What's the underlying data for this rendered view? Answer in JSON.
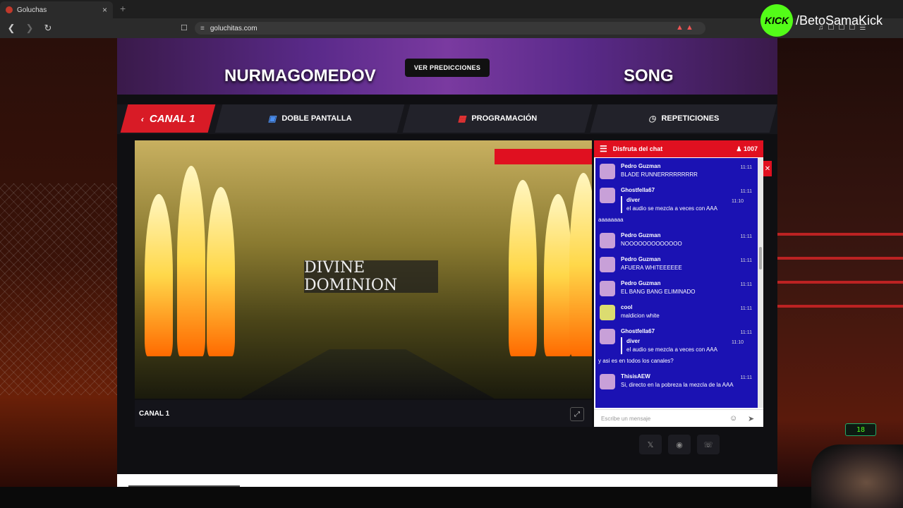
{
  "browser": {
    "tab_title": "Goluchas",
    "tab_close": "×",
    "new_tab": "+",
    "url": "goluchitas.com"
  },
  "overlay": {
    "kick_logo": "KICK",
    "kick_handle": "/BetoSamaKick",
    "viewer_badge": "18"
  },
  "banner": {
    "fighter_left": "NURMAGOMEDOV",
    "fighter_right": "SONG",
    "predictions_button": "VER PREDICCIONES"
  },
  "nav": {
    "tabs": [
      {
        "label": "CANAL 1",
        "icon": "chevron-left-icon"
      },
      {
        "label": "DOBLE PANTALLA",
        "icon": "monitor-icon"
      },
      {
        "label": "PROGRAMACIÓN",
        "icon": "calendar-icon"
      },
      {
        "label": "REPETICIONES",
        "icon": "clock-icon"
      }
    ]
  },
  "video": {
    "stage_text": "DIVINE DOMINION",
    "channel_label": "CANAL 1"
  },
  "chat": {
    "title": "Disfruta del chat",
    "viewer_count": "1007",
    "input_placeholder": "Escribe un mensaje",
    "messages": [
      {
        "user": "Pedro Guzman",
        "time": "11:11",
        "text": "BLADE RUNNERRRRRRRRR"
      },
      {
        "user": "Ghostfella67",
        "time": "11:11",
        "reply_user": "diver",
        "reply_time": "11:10",
        "reply_text": "el audio se mezcla a veces con AAA",
        "text": "aaaaaaaa"
      },
      {
        "user": "Pedro Guzman",
        "time": "11:11",
        "text": "NOOOOOOOOOOOOO"
      },
      {
        "user": "Pedro Guzman",
        "time": "11:11",
        "text": "AFUERA WHITEEEEEE"
      },
      {
        "user": "Pedro Guzman",
        "time": "11:11",
        "text": "EL BANG BANG ELIMINADO"
      },
      {
        "user": "cool",
        "time": "11:11",
        "text": "maldicion white"
      },
      {
        "user": "Ghostfella67",
        "time": "11:11",
        "reply_user": "diver",
        "reply_time": "11:10",
        "reply_text": "el audio se mezcla a veces con AAA",
        "text": "y asi es en todos los canales?"
      },
      {
        "user": "ThisisAEW",
        "time": "11:11",
        "text": "Si, directo en la pobreza la mezcla de la AAA"
      }
    ]
  },
  "colors": {
    "accent_red": "#e01020",
    "chat_bg": "#1b12b3",
    "kick_green": "#53fc18"
  }
}
